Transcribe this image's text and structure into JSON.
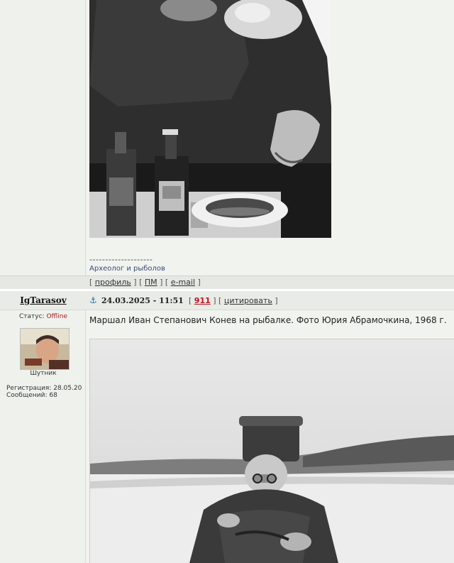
{
  "previous_post": {
    "signature_separator": "--------------------",
    "signature_text": "Археолог и рыболов",
    "actions": {
      "profile": "профиль",
      "pm": "ПМ",
      "email": "e-mail"
    }
  },
  "post": {
    "author": "IgTarasov",
    "date": "24.03.2025 - 11:51",
    "number": "911",
    "quote": "цитировать",
    "status_label": "Статус:",
    "status_value": "Offline",
    "rank": "Шутник",
    "registration": "Регистрация: 28.05.20",
    "messages": "Сообщений: 68",
    "text": "Маршал Иван Степанович Конев на рыбалке. Фото Юрия Абрамочкина, 1968 г."
  },
  "colors": {
    "page_bg": "#f1f3ee",
    "link": "#3b4a7a",
    "offline": "#b11d1d",
    "post_number": "#c1121f",
    "anchor": "#1a6fa6"
  },
  "icons": [
    "anchor-icon"
  ]
}
